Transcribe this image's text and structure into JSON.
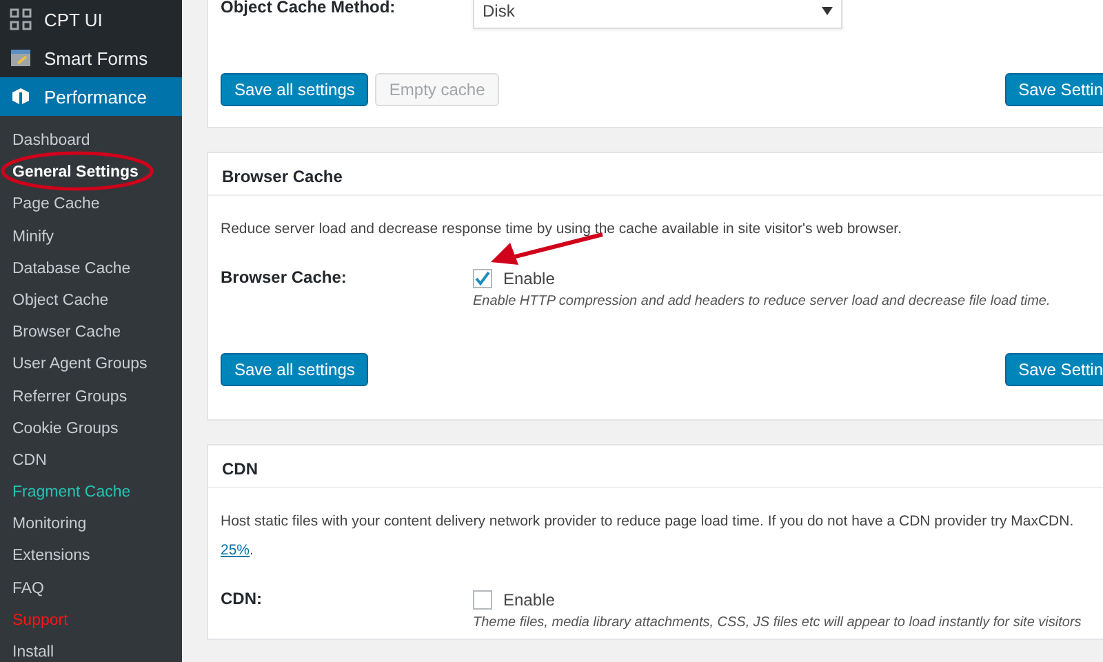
{
  "sidebar": {
    "menu": [
      {
        "label": "CPT UI",
        "selected": false
      },
      {
        "label": "Smart Forms",
        "selected": false
      },
      {
        "label": "Performance",
        "selected": true
      }
    ],
    "submenu": [
      {
        "label": "Dashboard",
        "kind": "plain",
        "selected": false
      },
      {
        "label": "General Settings",
        "kind": "plain",
        "selected": true
      },
      {
        "label": "Page Cache",
        "kind": "plain",
        "selected": false
      },
      {
        "label": "Minify",
        "kind": "plain",
        "selected": false
      },
      {
        "label": "Database Cache",
        "kind": "plain",
        "selected": false
      },
      {
        "label": "Object Cache",
        "kind": "plain",
        "selected": false
      },
      {
        "label": "Browser Cache",
        "kind": "plain",
        "selected": false
      },
      {
        "label": "User Agent Groups",
        "kind": "plain",
        "selected": false
      },
      {
        "label": "Referrer Groups",
        "kind": "plain",
        "selected": false
      },
      {
        "label": "Cookie Groups",
        "kind": "plain",
        "selected": false
      },
      {
        "label": "CDN",
        "kind": "plain",
        "selected": false
      },
      {
        "label": "Fragment Cache",
        "kind": "accent",
        "selected": false
      },
      {
        "label": "Monitoring",
        "kind": "plain",
        "selected": false
      },
      {
        "label": "Extensions",
        "kind": "plain",
        "selected": false
      },
      {
        "label": "FAQ",
        "kind": "plain",
        "selected": false
      },
      {
        "label": "Support",
        "kind": "alert",
        "selected": false
      },
      {
        "label": "Install",
        "kind": "plain",
        "selected": false
      }
    ]
  },
  "panels": [
    {
      "rows": [
        {
          "label": "Object Cache Method:",
          "kind": "select",
          "value": "Disk"
        }
      ],
      "buttons": [
        {
          "label": "Save all settings",
          "disabled": false
        },
        {
          "label": "Empty cache",
          "disabled": true
        }
      ],
      "right_button": "Save Settin"
    },
    {
      "title": "Browser Cache",
      "description": "Reduce server load and decrease response time by using the cache available in site visitor's web browser.",
      "rows": [
        {
          "label": "Browser Cache:",
          "kind": "checkbox",
          "checked": true,
          "option": "Enable",
          "note": "Enable HTTP compression and add headers to reduce server load and decrease file load time."
        }
      ],
      "buttons": [
        {
          "label": "Save all settings",
          "disabled": false
        }
      ],
      "right_button": "Save Settin"
    },
    {
      "title": "CDN",
      "description": "Host static files with your content delivery network provider to reduce page load time. If you do not have a CDN provider try MaxCDN.",
      "link": "25%",
      "link_after": ".",
      "rows": [
        {
          "label": "CDN:",
          "kind": "checkbox",
          "checked": false,
          "option": "Enable",
          "note": "Theme files, media library attachments, CSS, JS files etc will appear to load instantly for site visitors"
        }
      ]
    }
  ]
}
